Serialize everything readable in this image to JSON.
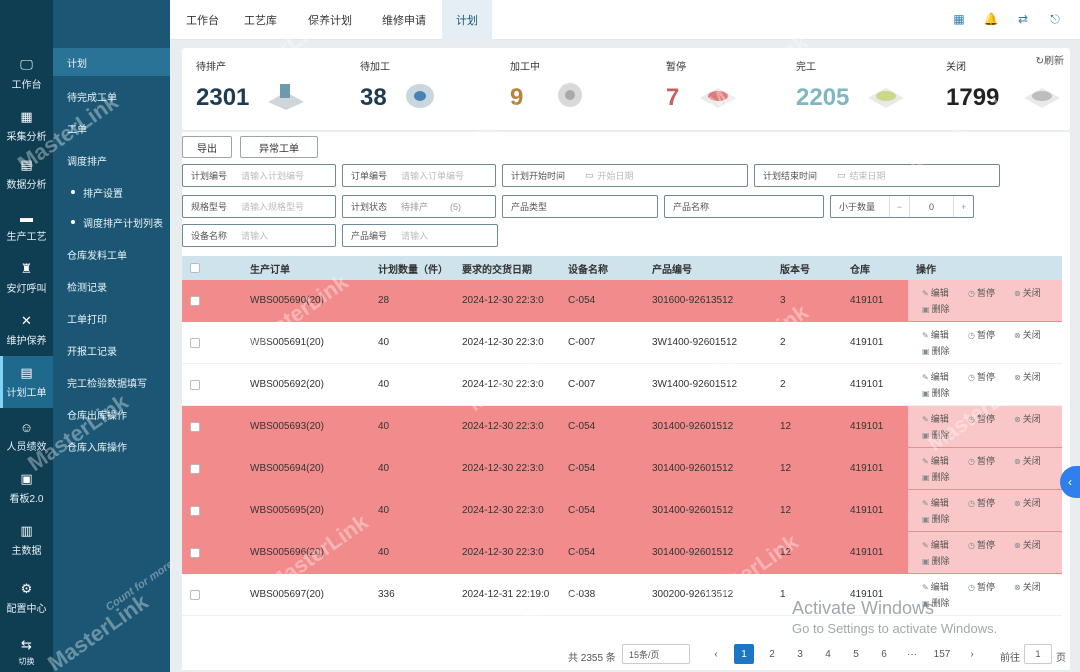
{
  "rail": {
    "items": [
      {
        "label": "工作台",
        "icon": "monitor-icon"
      },
      {
        "label": "采集分析",
        "icon": "grid-icon"
      },
      {
        "label": "数据分析",
        "icon": "chart-icon"
      },
      {
        "label": "生产工艺",
        "icon": "folder-icon"
      },
      {
        "label": "安灯呼叫",
        "icon": "lamp-icon"
      },
      {
        "label": "维护保养",
        "icon": "tools-icon"
      },
      {
        "label": "计划工单",
        "icon": "document-icon"
      },
      {
        "label": "人员绩效",
        "icon": "user-icon"
      },
      {
        "label": "看板2.0",
        "icon": "board-icon"
      },
      {
        "label": "主数据",
        "icon": "database-icon"
      },
      {
        "label": "配置中心",
        "icon": "gear-icon"
      },
      {
        "label": "切换",
        "icon": "switch-icon"
      }
    ]
  },
  "subnav": {
    "items": [
      "计划",
      "待完成工单",
      "工单",
      "调度排产",
      "排产设置",
      "调度排产计划列表",
      "仓库发料工单",
      "检测记录",
      "工单打印",
      "开报工记录",
      "完工检验数据填写",
      "仓库出库操作",
      "仓库入库操作"
    ]
  },
  "tabs": [
    "工作台",
    "工艺库",
    "保养计划",
    "维修申请",
    "计划"
  ],
  "stats": {
    "refresh_label": "刷新",
    "cards": [
      {
        "label": "待排产",
        "value": "2301",
        "color": "#1f3b52"
      },
      {
        "label": "待加工",
        "value": "38",
        "color": "#1f3b52"
      },
      {
        "label": "加工中",
        "value": "9",
        "color": "#b7823b"
      },
      {
        "label": "暂停",
        "value": "7",
        "color": "#c9605e"
      },
      {
        "label": "完工",
        "value": "2205",
        "color": "#7fb6c2"
      },
      {
        "label": "关闭",
        "value": "1799",
        "color": "#222222"
      }
    ]
  },
  "actions": {
    "export_label": "导出",
    "abnormal_label": "异常工单"
  },
  "filters": {
    "plan_no": {
      "label": "计划编号",
      "placeholder": "请输入计划编号"
    },
    "order_no": {
      "label": "订单编号",
      "placeholder": "请输入订单编号"
    },
    "plan_start": {
      "label": "计划开始时间",
      "placeholder": "开始日期"
    },
    "plan_end": {
      "label": "计划结束时间",
      "placeholder": "结束日期"
    },
    "spec": {
      "label": "规格型号",
      "placeholder": "请输入规格型号"
    },
    "plan_status": {
      "label": "计划状态",
      "value": "待排产",
      "extra": "(5)"
    },
    "product_type": {
      "label": "产品类型"
    },
    "product_name": {
      "label": "产品名称"
    },
    "qty_lt": {
      "label": "小于数量",
      "value": "0",
      "minus": "−",
      "plus": "+"
    },
    "device_name": {
      "label": "设备名称",
      "placeholder": "请输入"
    },
    "product_code": {
      "label": "产品编号",
      "placeholder": "请输入"
    }
  },
  "table": {
    "headers": [
      "生产订单",
      "计划数量（件）",
      "要求的交货日期",
      "设备名称",
      "产品编号",
      "版本号",
      "仓库",
      "操作"
    ],
    "op_labels": {
      "edit": "编辑",
      "pause": "暂停",
      "close": "关闭",
      "delete": "删除"
    },
    "rows": [
      {
        "order": "WBS005690(20)",
        "qty": "28",
        "date": "2024-12-30 22:3:0",
        "device": "C-054",
        "product": "301600-92613512",
        "version": "3",
        "warehouse": "419101",
        "highlight": true
      },
      {
        "order": "WBS005691(20)",
        "qty": "40",
        "date": "2024-12-30 22:3:0",
        "device": "C-007",
        "product": "3W1400-92601512",
        "version": "2",
        "warehouse": "419101",
        "highlight": false
      },
      {
        "order": "WBS005692(20)",
        "qty": "40",
        "date": "2024-12-30 22:3:0",
        "device": "C-007",
        "product": "3W1400-92601512",
        "version": "2",
        "warehouse": "419101",
        "highlight": false
      },
      {
        "order": "WBS005693(20)",
        "qty": "40",
        "date": "2024-12-30 22:3:0",
        "device": "C-054",
        "product": "301400-92601512",
        "version": "12",
        "warehouse": "419101",
        "highlight": true
      },
      {
        "order": "WBS005694(20)",
        "qty": "40",
        "date": "2024-12-30 22:3:0",
        "device": "C-054",
        "product": "301400-92601512",
        "version": "12",
        "warehouse": "419101",
        "highlight": true
      },
      {
        "order": "WBS005695(20)",
        "qty": "40",
        "date": "2024-12-30 22:3:0",
        "device": "C-054",
        "product": "301400-92601512",
        "version": "12",
        "warehouse": "419101",
        "highlight": true
      },
      {
        "order": "WBS005696(20)",
        "qty": "40",
        "date": "2024-12-30 22:3:0",
        "device": "C-054",
        "product": "301400-92601512",
        "version": "12",
        "warehouse": "419101",
        "highlight": true
      },
      {
        "order": "WBS005697(20)",
        "qty": "336",
        "date": "2024-12-31 22:19:0",
        "device": "C-038",
        "product": "300200-92613512",
        "version": "1",
        "warehouse": "419101",
        "highlight": false
      }
    ]
  },
  "pagination": {
    "total": "共 2355 条",
    "page_size": "15条/页",
    "prev": "‹",
    "pages": [
      "1",
      "2",
      "3",
      "4",
      "5",
      "6",
      "···",
      "157"
    ],
    "next": "›",
    "goto_label": "前往",
    "goto_value": "1",
    "page_suffix": "页"
  },
  "watermark": {
    "brand": "MasterLink",
    "tagline": "Count for more"
  },
  "os_notice": {
    "title": "Activate Windows",
    "subtitle": "Go to Settings to activate Windows."
  },
  "colors": {
    "rail": "#0f3e53",
    "subnav": "#1b5774",
    "highlight_row": "#f28c8c",
    "header": "#cfe3ec",
    "accent": "#1c76c3"
  }
}
